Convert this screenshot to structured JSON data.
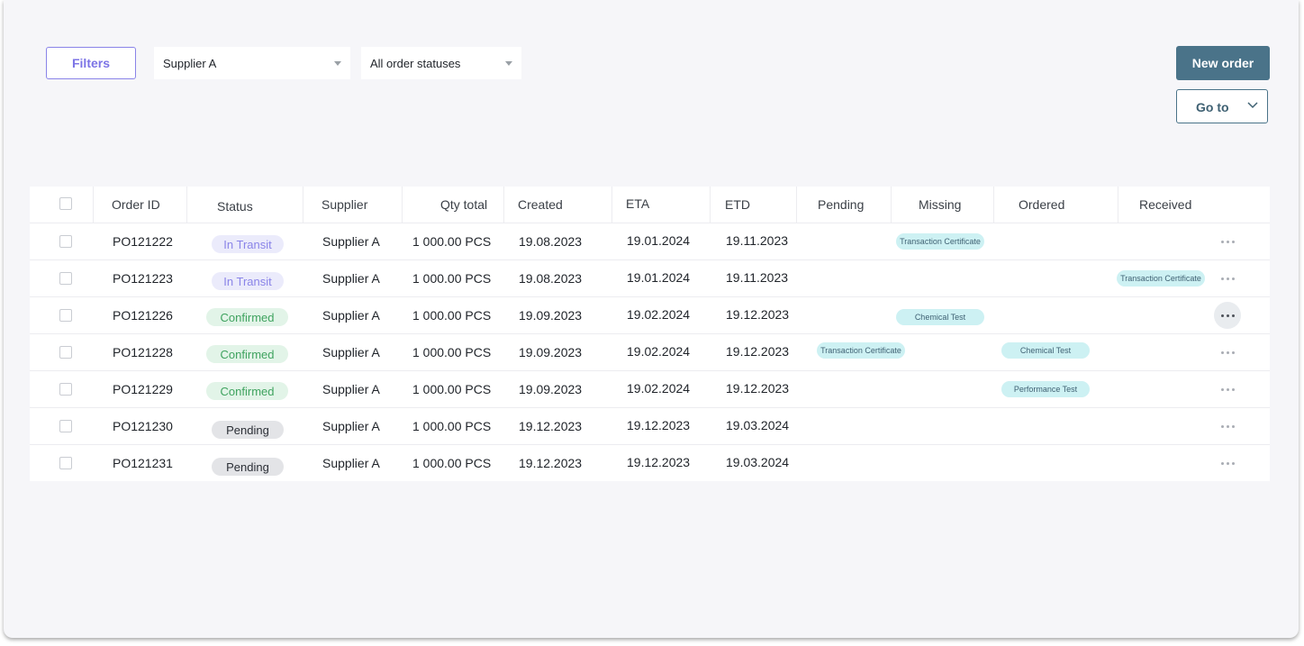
{
  "toolbar": {
    "filters_label": "Filters",
    "supplier_select": "Supplier A",
    "status_select": "All order statuses",
    "new_order_label": "New order",
    "goto_label": "Go to"
  },
  "table": {
    "columns": [
      "Order ID",
      "Status",
      "Supplier",
      "Qty total",
      "Created",
      "ETA",
      "ETD",
      "Pending",
      "Missing",
      "Ordered",
      "Received"
    ],
    "rows": [
      {
        "id": "PO121222",
        "status": "In Transit",
        "status_type": "transit",
        "supplier": "Supplier A",
        "qty": "1 000.00 PCS",
        "created": "19.08.2023",
        "eta": "19.01.2024",
        "etd": "19.11.2023",
        "pending": "",
        "missing": "Transaction Certificate",
        "ordered": "",
        "received": ""
      },
      {
        "id": "PO121223",
        "status": "In Transit",
        "status_type": "transit",
        "supplier": "Supplier A",
        "qty": "1 000.00 PCS",
        "created": "19.08.2023",
        "eta": "19.01.2024",
        "etd": "19.11.2023",
        "pending": "",
        "missing": "",
        "ordered": "",
        "received": "Transaction Certificate"
      },
      {
        "id": "PO121226",
        "status": "Confirmed",
        "status_type": "confirmed",
        "supplier": "Supplier A",
        "qty": "1 000.00 PCS",
        "created": "19.09.2023",
        "eta": "19.02.2024",
        "etd": "19.12.2023",
        "pending": "",
        "missing": "Chemical Test",
        "ordered": "",
        "received": ""
      },
      {
        "id": "PO121228",
        "status": "Confirmed",
        "status_type": "confirmed",
        "supplier": "Supplier A",
        "qty": "1 000.00 PCS",
        "created": "19.09.2023",
        "eta": "19.02.2024",
        "etd": "19.12.2023",
        "pending": "Transaction Certificate",
        "missing": "",
        "ordered": "Chemical Test",
        "received": ""
      },
      {
        "id": "PO121229",
        "status": "Confirmed",
        "status_type": "confirmed",
        "supplier": "Supplier A",
        "qty": "1 000.00 PCS",
        "created": "19.09.2023",
        "eta": "19.02.2024",
        "etd": "19.12.2023",
        "pending": "",
        "missing": "",
        "ordered": "Performance Test",
        "received": ""
      },
      {
        "id": "PO121230",
        "status": "Pending",
        "status_type": "pending",
        "supplier": "Supplier A",
        "qty": "1 000.00 PCS",
        "created": "19.12.2023",
        "eta": "19.12.2023",
        "etd": "19.03.2024",
        "pending": "",
        "missing": "",
        "ordered": "",
        "received": ""
      },
      {
        "id": "PO121231",
        "status": "Pending",
        "status_type": "pending",
        "supplier": "Supplier A",
        "qty": "1 000.00 PCS",
        "created": "19.12.2023",
        "eta": "19.12.2023",
        "etd": "19.03.2024",
        "pending": "",
        "missing": "",
        "ordered": "",
        "received": ""
      }
    ]
  },
  "colors": {
    "accent": "#4a7389",
    "filters": "#7c74e6",
    "transit_bg": "#ebebfb",
    "transit_fg": "#8a84e8",
    "confirmed_bg": "#e2f4e8",
    "confirmed_fg": "#3fa35f",
    "pending_bg": "#e3e4e7",
    "pending_fg": "#2b2f36",
    "tag_bg": "#cdf1f3"
  },
  "icons": {
    "row_menu": "more-horizontal-icon",
    "goto_caret": "chevron-down-icon",
    "select_caret": "caret-down-icon"
  }
}
